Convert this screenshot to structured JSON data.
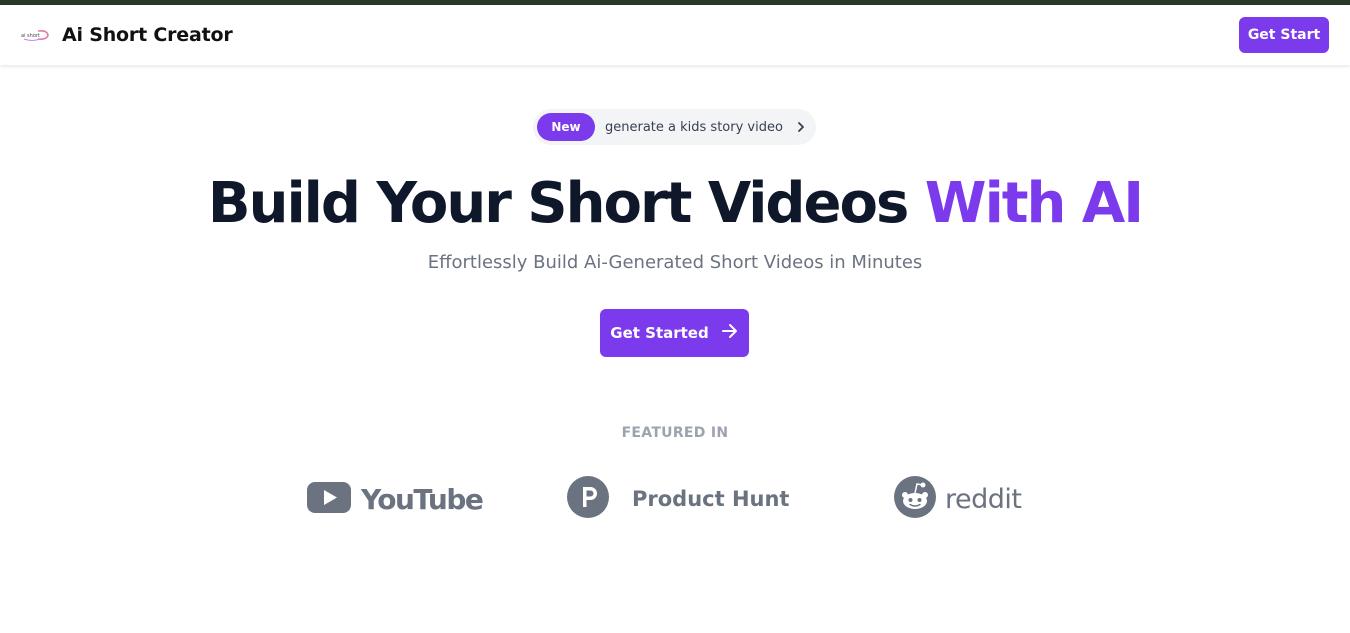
{
  "header": {
    "brand_name": "Ai Short Creator",
    "cta_label": "Get Start"
  },
  "announcement": {
    "badge": "New",
    "text": "generate a kids story video"
  },
  "hero": {
    "title_main": "Build Your Short Videos",
    "title_accent": "With AI",
    "subtitle": "Effortlessly Build Ai-Generated Short Videos in Minutes",
    "cta_label": "Get Started"
  },
  "featured": {
    "heading": "FEATURED IN",
    "logos": [
      {
        "name": "YouTube",
        "icon": "youtube-icon"
      },
      {
        "name": "Product Hunt",
        "icon": "product-hunt-icon"
      },
      {
        "name": "reddit",
        "icon": "reddit-icon"
      }
    ]
  },
  "colors": {
    "accent": "#7c3aed",
    "heading": "#0f172a",
    "muted": "#6b7280",
    "top_strip": "#2a3a2a"
  }
}
